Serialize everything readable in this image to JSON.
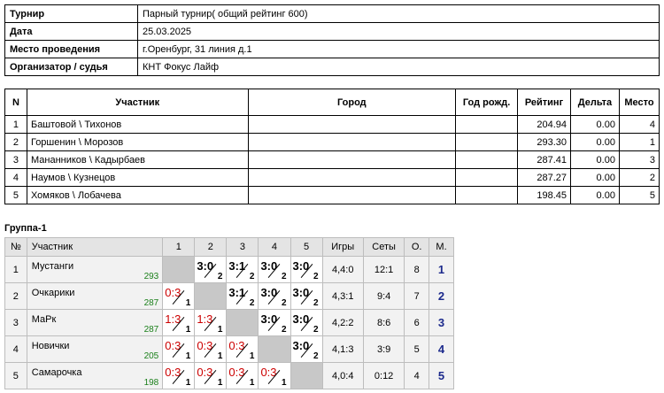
{
  "info": {
    "tournament_label": "Турнир",
    "tournament_value": "Парный турнир( общий рейтинг 600)",
    "date_label": "Дата",
    "date_value": "25.03.2025",
    "venue_label": "Место проведения",
    "venue_value": "г.Оренбург, 31 линия д.1",
    "organizer_label": "Организатор / судья",
    "organizer_value": "КНТ Фокус Лайф"
  },
  "participants": {
    "headers": [
      "N",
      "Участник",
      "Город",
      "Год рожд.",
      "Рейтинг",
      "Дельта",
      "Место"
    ],
    "rows": [
      {
        "n": "1",
        "name": "Баштовой \\ Тихонов",
        "city": "",
        "year": "",
        "rating": "204.94",
        "delta": "0.00",
        "place": "4"
      },
      {
        "n": "2",
        "name": "Горшенин \\ Морозов",
        "city": "",
        "year": "",
        "rating": "293.30",
        "delta": "0.00",
        "place": "1"
      },
      {
        "n": "3",
        "name": "Мананников \\ Кадырбаев",
        "city": "",
        "year": "",
        "rating": "287.41",
        "delta": "0.00",
        "place": "3"
      },
      {
        "n": "4",
        "name": "Наумов \\ Кузнецов",
        "city": "",
        "year": "",
        "rating": "287.27",
        "delta": "0.00",
        "place": "2"
      },
      {
        "n": "5",
        "name": "Хомяков \\ Лобачева",
        "city": "",
        "year": "",
        "rating": "198.45",
        "delta": "0.00",
        "place": "5"
      }
    ]
  },
  "group": {
    "title": "Группа-1",
    "headers": {
      "num": "№",
      "player": "Участник",
      "cols": [
        "1",
        "2",
        "3",
        "4",
        "5"
      ],
      "games": "Игры",
      "sets": "Сеты",
      "points": "О.",
      "place": "М."
    },
    "rows": [
      {
        "num": "1",
        "name": "Мустанги",
        "rating": "293",
        "cells": [
          null,
          {
            "score": "3:0",
            "pts": "2",
            "win": true
          },
          {
            "score": "3:1",
            "pts": "2",
            "win": true
          },
          {
            "score": "3:0",
            "pts": "2",
            "win": true
          },
          {
            "score": "3:0",
            "pts": "2",
            "win": true
          }
        ],
        "games": "4,4:0",
        "sets": "12:1",
        "points": "8",
        "place": "1"
      },
      {
        "num": "2",
        "name": "Очкарики",
        "rating": "287",
        "cells": [
          {
            "score": "0:3",
            "pts": "1",
            "win": false
          },
          null,
          {
            "score": "3:1",
            "pts": "2",
            "win": true
          },
          {
            "score": "3:0",
            "pts": "2",
            "win": true
          },
          {
            "score": "3:0",
            "pts": "2",
            "win": true
          }
        ],
        "games": "4,3:1",
        "sets": "9:4",
        "points": "7",
        "place": "2"
      },
      {
        "num": "3",
        "name": "МаРк",
        "rating": "287",
        "cells": [
          {
            "score": "1:3",
            "pts": "1",
            "win": false
          },
          {
            "score": "1:3",
            "pts": "1",
            "win": false
          },
          null,
          {
            "score": "3:0",
            "pts": "2",
            "win": true
          },
          {
            "score": "3:0",
            "pts": "2",
            "win": true
          }
        ],
        "games": "4,2:2",
        "sets": "8:6",
        "points": "6",
        "place": "3"
      },
      {
        "num": "4",
        "name": "Новички",
        "rating": "205",
        "cells": [
          {
            "score": "0:3",
            "pts": "1",
            "win": false
          },
          {
            "score": "0:3",
            "pts": "1",
            "win": false
          },
          {
            "score": "0:3",
            "pts": "1",
            "win": false
          },
          null,
          {
            "score": "3:0",
            "pts": "2",
            "win": true
          }
        ],
        "games": "4,1:3",
        "sets": "3:9",
        "points": "5",
        "place": "4"
      },
      {
        "num": "5",
        "name": "Самарочка",
        "rating": "198",
        "cells": [
          {
            "score": "0:3",
            "pts": "1",
            "win": false
          },
          {
            "score": "0:3",
            "pts": "1",
            "win": false
          },
          {
            "score": "0:3",
            "pts": "1",
            "win": false
          },
          {
            "score": "0:3",
            "pts": "1",
            "win": false
          },
          null
        ],
        "games": "4,0:4",
        "sets": "0:12",
        "points": "4",
        "place": "5"
      }
    ]
  }
}
